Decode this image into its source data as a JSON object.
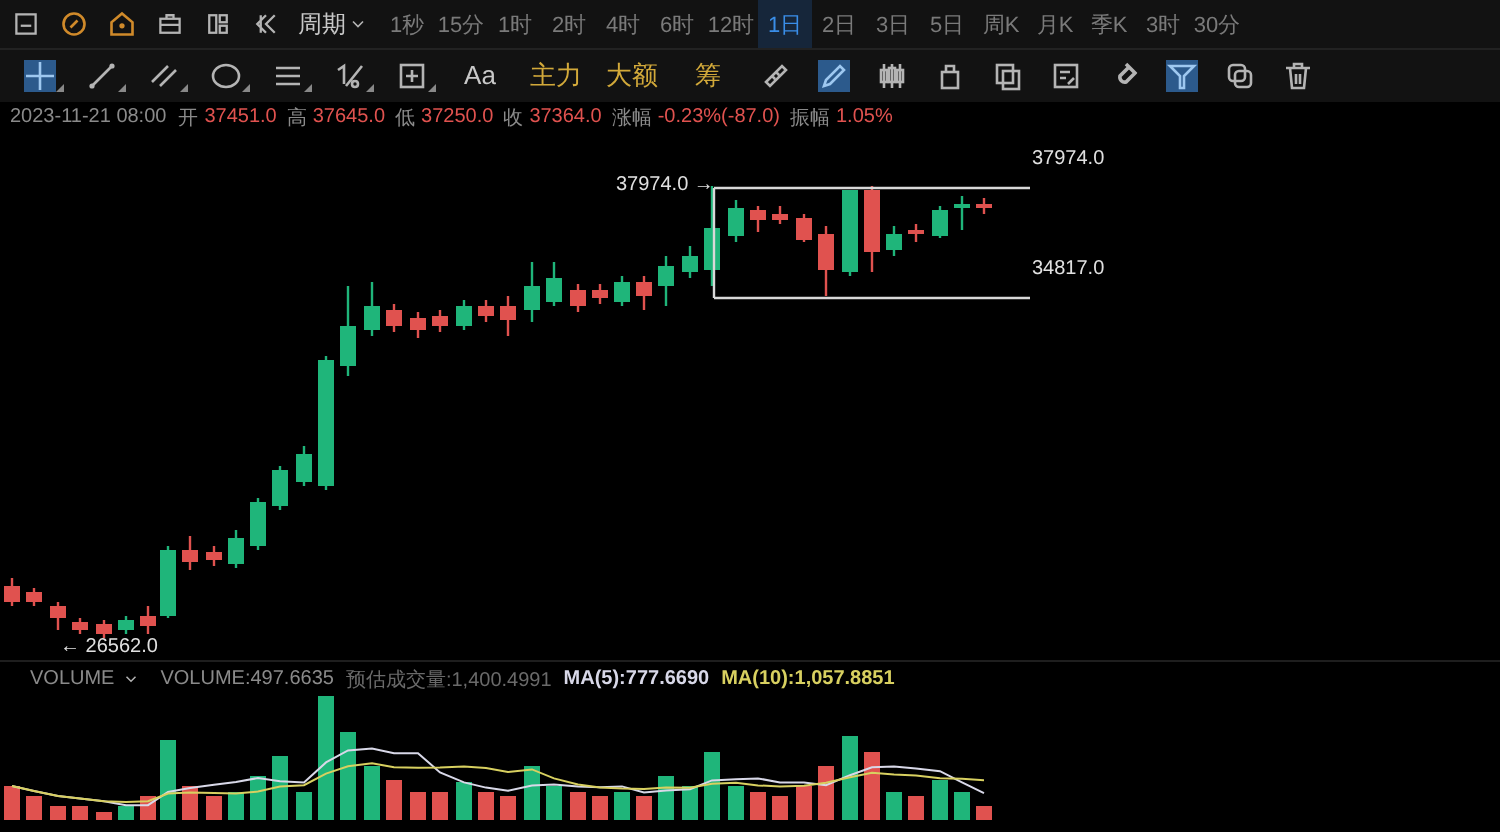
{
  "period_menu": {
    "label": "周期"
  },
  "periods": [
    {
      "label": "1秒",
      "selected": false
    },
    {
      "label": "15分",
      "selected": false
    },
    {
      "label": "1时",
      "selected": false
    },
    {
      "label": "2时",
      "selected": false
    },
    {
      "label": "4时",
      "selected": false
    },
    {
      "label": "6时",
      "selected": false
    },
    {
      "label": "12时",
      "selected": false
    },
    {
      "label": "1日",
      "selected": true
    },
    {
      "label": "2日",
      "selected": false
    },
    {
      "label": "3日",
      "selected": false
    },
    {
      "label": "5日",
      "selected": false
    },
    {
      "label": "周K",
      "selected": false
    },
    {
      "label": "月K",
      "selected": false
    },
    {
      "label": "季K",
      "selected": false
    },
    {
      "label": "3时",
      "selected": false
    },
    {
      "label": "30分",
      "selected": false
    }
  ],
  "tools": [
    {
      "kind": "icon",
      "active": true
    },
    {
      "kind": "icon",
      "active": false
    },
    {
      "kind": "icon",
      "active": false
    },
    {
      "kind": "icon",
      "active": false
    },
    {
      "kind": "icon",
      "active": false
    },
    {
      "kind": "icon",
      "active": false
    },
    {
      "kind": "icon",
      "active": false
    },
    {
      "kind": "label",
      "text": "Aa",
      "color": "#c8c8c8"
    },
    {
      "kind": "label",
      "text": "主力",
      "color": "#d2a93a"
    },
    {
      "kind": "label",
      "text": "大额",
      "color": "#d2a93a"
    },
    {
      "kind": "label",
      "text": "筹",
      "color": "#d2a93a"
    },
    {
      "kind": "icon",
      "active": false
    },
    {
      "kind": "icon",
      "active": true
    },
    {
      "kind": "icon",
      "active": false
    },
    {
      "kind": "icon",
      "active": false
    },
    {
      "kind": "icon",
      "active": false
    },
    {
      "kind": "icon",
      "active": false
    },
    {
      "kind": "icon",
      "active": false
    },
    {
      "kind": "icon",
      "active": true
    },
    {
      "kind": "icon",
      "active": false
    },
    {
      "kind": "icon",
      "active": false
    }
  ],
  "quote": {
    "time": "2023-11-21 08:00",
    "fields": [
      {
        "label": "开",
        "value": "37451.0"
      },
      {
        "label": "高",
        "value": "37645.0"
      },
      {
        "label": "低",
        "value": "37250.0"
      },
      {
        "label": "收",
        "value": "37364.0"
      },
      {
        "label": "涨幅",
        "value": "-0.23%(-87.0)"
      },
      {
        "label": "振幅",
        "value": "1.05%"
      }
    ]
  },
  "price_chart": {
    "range_label": "37974.0 →",
    "high_label": "37974.0",
    "low_range_label": "34817.0",
    "low_label": "← 26562.0"
  },
  "volume_panel": {
    "indicator": "VOLUME",
    "readings": [
      {
        "text": "VOLUME:497.6635",
        "color": "#8a8a8a"
      },
      {
        "text": "预估成交量:1,400.4991",
        "color": "#6a6a6a"
      },
      {
        "text": "MA(5):777.6690",
        "color": "#d8d8e8"
      },
      {
        "text": "MA(10):1,057.8851",
        "color": "#d8d060"
      }
    ]
  }
}
